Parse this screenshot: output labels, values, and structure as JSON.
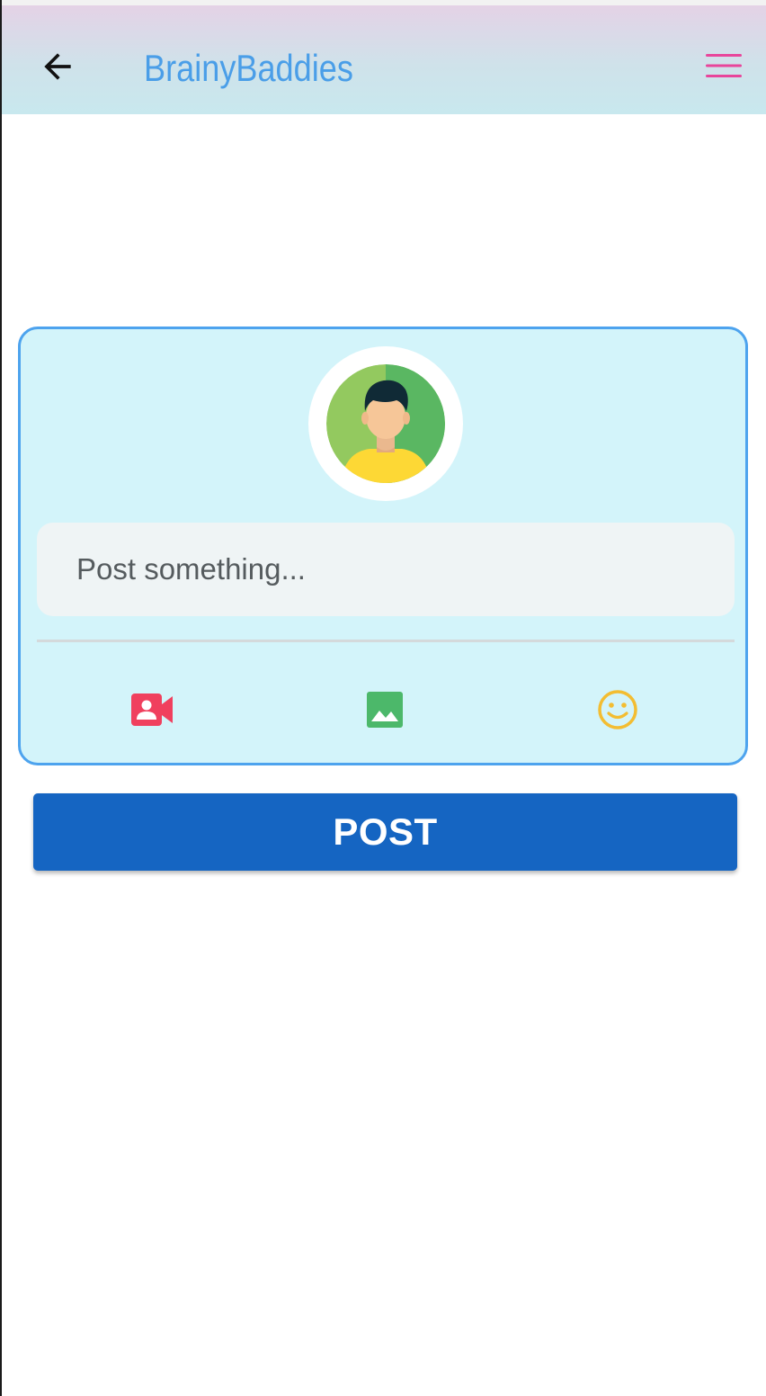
{
  "app_bar": {
    "title": "BrainyBaddies",
    "back_icon": "arrow-left-icon",
    "menu_icon": "hamburger-menu-icon",
    "title_color": "#4a9ee8",
    "menu_color": "#e8459b"
  },
  "composer": {
    "avatar_icon": "user-avatar-icon",
    "input_placeholder": "Post something...",
    "input_value": "",
    "actions": [
      {
        "icon": "video-call-icon",
        "color": "#f0405e"
      },
      {
        "icon": "image-icon",
        "color": "#4cb86a"
      },
      {
        "icon": "smiley-emoji-icon",
        "color": "#f3bd32"
      }
    ],
    "card_background": "#d3f4fa",
    "card_border": "#4da3ee"
  },
  "post_button": {
    "label": "POST",
    "color": "#1565c2"
  }
}
